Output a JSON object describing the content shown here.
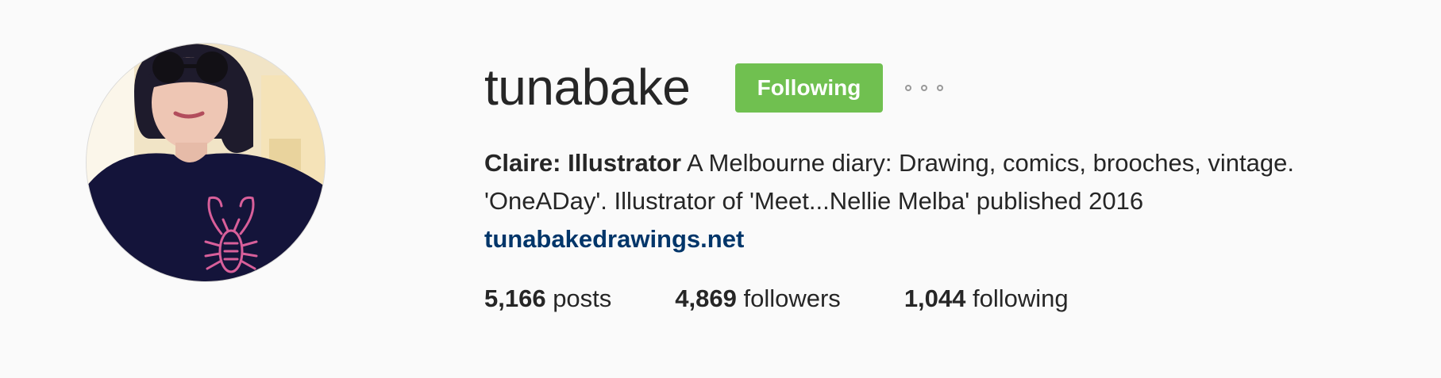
{
  "profile": {
    "username": "tunabake",
    "follow_button_label": "Following",
    "more_options_icon": "more-horizontal-icon",
    "bio": {
      "name": "Claire: Illustrator",
      "text_line1": " A Melbourne diary: Drawing, comics, brooches, vintage.",
      "text_line2": "'OneADay'. Illustrator of 'Meet...Nellie Melba' published 2016",
      "website": "tunabakedrawings.net"
    },
    "stats": {
      "posts_count": "5,166",
      "posts_label": " posts",
      "followers_count": "4,869",
      "followers_label": " followers",
      "following_count": "1,044",
      "following_label": " following"
    }
  },
  "colors": {
    "follow_button": "#70c050",
    "link": "#003569",
    "background": "#fafafa",
    "text": "#262626"
  }
}
